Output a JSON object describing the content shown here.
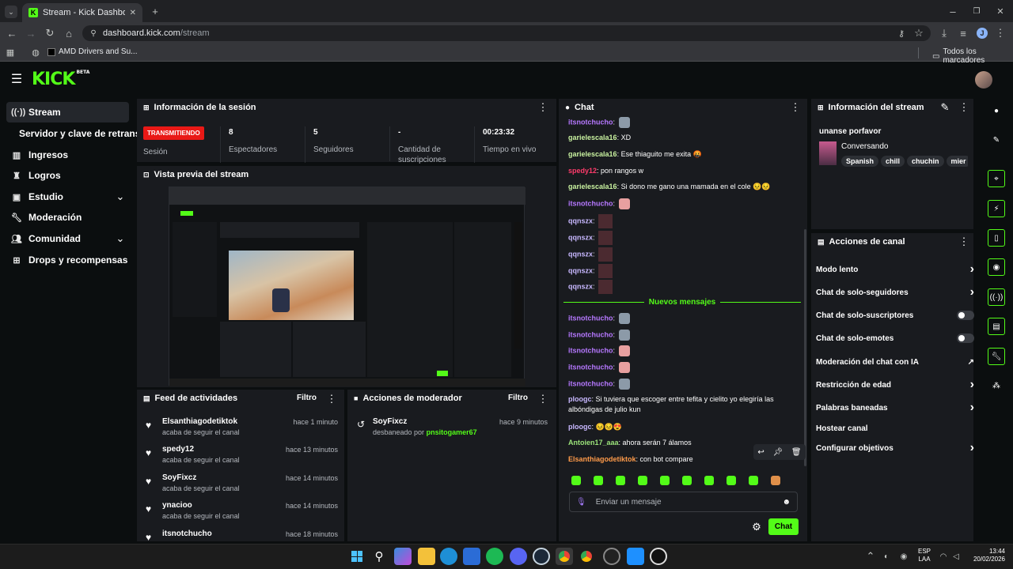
{
  "browser": {
    "tab_title": "Stream - Kick Dashboard",
    "url_host": "dashboard.kick.com",
    "url_path": "/stream",
    "bookmark_1": "AMD Drivers and Su...",
    "all_bookmarks": "Todos los marcadores",
    "profile_initial": "J"
  },
  "app": {
    "logo": "KICK",
    "logo_sup": "BETA"
  },
  "sidebar": {
    "items": [
      {
        "label": "Stream",
        "icon": "radio-icon"
      },
      {
        "label": "Servidor y clave de retransm",
        "icon": ""
      },
      {
        "label": "Ingresos",
        "icon": "bank-icon"
      },
      {
        "label": "Logros",
        "icon": "trophy-icon"
      },
      {
        "label": "Estudio",
        "icon": "layout-icon"
      },
      {
        "label": "Moderación",
        "icon": "wrench-icon"
      },
      {
        "label": "Comunidad",
        "icon": "users-icon"
      },
      {
        "label": "Drops y recompensas",
        "icon": "gift-icon"
      }
    ]
  },
  "session": {
    "title": "Información de la sesión",
    "live_badge": "TRANSMITIENDO",
    "session_label": "Sesión",
    "viewers_value": "8",
    "viewers_label": "Espectadores",
    "followers_value": "5",
    "followers_label": "Seguidores",
    "subs_value": "-",
    "subs_label": "Cantidad de suscripciones",
    "time_value": "00:23:32",
    "time_label": "Tiempo en vivo"
  },
  "preview": {
    "title": "Vista previa del stream"
  },
  "feed": {
    "title": "Feed de actividades",
    "filter": "Filtro",
    "items": [
      {
        "name": "Elsanthiagodetiktok",
        "sub": "acaba de seguir el canal",
        "time": "hace 1 minuto"
      },
      {
        "name": "spedy12",
        "sub": "acaba de seguir el canal",
        "time": "hace 13 minutos"
      },
      {
        "name": "SoyFixcz",
        "sub": "acaba de seguir el canal",
        "time": "hace 14 minutos"
      },
      {
        "name": "ynacioo",
        "sub": "acaba de seguir el canal",
        "time": "hace 14 minutos"
      },
      {
        "name": "itsnotchucho",
        "sub": "",
        "time": "hace 18 minutos"
      }
    ]
  },
  "modactions": {
    "title": "Acciones de moderador",
    "filter": "Filtro",
    "items": [
      {
        "name": "SoyFixcz",
        "sub_prefix": "desbaneado por",
        "sub_by": "pnsitogamer67",
        "time": "hace 9 minutos"
      }
    ]
  },
  "chat": {
    "title": "Chat",
    "new_messages": "Nuevos mensajes",
    "input_placeholder": "Enviar un mensaje",
    "send_label": "Chat",
    "messages": [
      {
        "user": "itsnotchucho",
        "color": "#b678ff",
        "text": "",
        "emote": "gray"
      },
      {
        "user": "garielescala16",
        "color": "#c9f2a0",
        "text": "XD",
        "emote": ""
      },
      {
        "user": "garielescala16",
        "color": "#c9f2a0",
        "text": "Ese thiaguito me exita 🤬",
        "emote": ""
      },
      {
        "user": "spedy12",
        "color": "#ff3b6b",
        "text": "pon rangos w",
        "emote": ""
      },
      {
        "user": "garielescala16",
        "color": "#c9f2a0",
        "text": "Si dono me gano una mamada en el cole 😣😣",
        "emote": ""
      },
      {
        "user": "itsnotchucho",
        "color": "#b678ff",
        "text": "",
        "emote": "pink"
      },
      {
        "user": "qqnszx",
        "color": "#c8b8ff",
        "text": "",
        "emote": "tile"
      },
      {
        "user": "qqnszx",
        "color": "#c8b8ff",
        "text": "",
        "emote": "tile"
      },
      {
        "user": "qqnszx",
        "color": "#c8b8ff",
        "text": "",
        "emote": "tile"
      },
      {
        "user": "qqnszx",
        "color": "#c8b8ff",
        "text": "",
        "emote": "tile"
      },
      {
        "user": "qqnszx",
        "color": "#c8b8ff",
        "text": "",
        "emote": "tile"
      },
      {
        "user": "itsnotchucho",
        "color": "#b678ff",
        "text": "",
        "emote": "gray"
      },
      {
        "user": "itsnotchucho",
        "color": "#b678ff",
        "text": "",
        "emote": "gray"
      },
      {
        "user": "itsnotchucho",
        "color": "#b678ff",
        "text": "",
        "emote": "pink"
      },
      {
        "user": "itsnotchucho",
        "color": "#b678ff",
        "text": "",
        "emote": "pink"
      },
      {
        "user": "itsnotchucho",
        "color": "#b678ff",
        "text": "",
        "emote": "gray"
      },
      {
        "user": "ploogc",
        "color": "#c8b8ff",
        "text": "Si tuviera que escoger entre tefita y cielito yo elegiría las albóndigas de julio kun",
        "emote": ""
      },
      {
        "user": "ploogc",
        "color": "#c8b8ff",
        "text": "😣😣😍",
        "emote": ""
      },
      {
        "user": "Antoien17_aaa",
        "color": "#9be37a",
        "text": "ahora serán 7 álamos",
        "emote": ""
      },
      {
        "user": "Elsanthiagodetiktok",
        "color": "#ff9b4a",
        "text": "con bot compare",
        "emote": ""
      }
    ]
  },
  "streaminfo": {
    "title": "Información del stream",
    "stream_title": "unanse porfavor",
    "category": "Conversando",
    "tags": [
      "Spanish",
      "chill",
      "chuchin",
      "mier"
    ]
  },
  "channel_actions": {
    "title": "Acciones de canal",
    "items": [
      {
        "label": "Modo lento",
        "control": "chevron"
      },
      {
        "label": "Chat de solo-seguidores",
        "control": "chevron"
      },
      {
        "label": "Chat de solo-suscriptores",
        "control": "toggle"
      },
      {
        "label": "Chat de solo-emotes",
        "control": "toggle"
      },
      {
        "label": "Moderación del chat con IA",
        "control": "external"
      },
      {
        "label": "Restricción de edad",
        "control": "chevron"
      },
      {
        "label": "Palabras baneadas",
        "control": "chevron"
      },
      {
        "label": "Hostear canal",
        "control": ""
      },
      {
        "label": "Configurar objetivos",
        "control": "chevron"
      }
    ]
  },
  "taskbar": {
    "lang": "ESP",
    "lang2": "LAA",
    "time": "13:44",
    "date": "20/02/2026"
  },
  "colors": {
    "accent": "#53fc18",
    "live": "#e91916",
    "panel": "#191b1f",
    "bg": "#0b0e0f"
  }
}
